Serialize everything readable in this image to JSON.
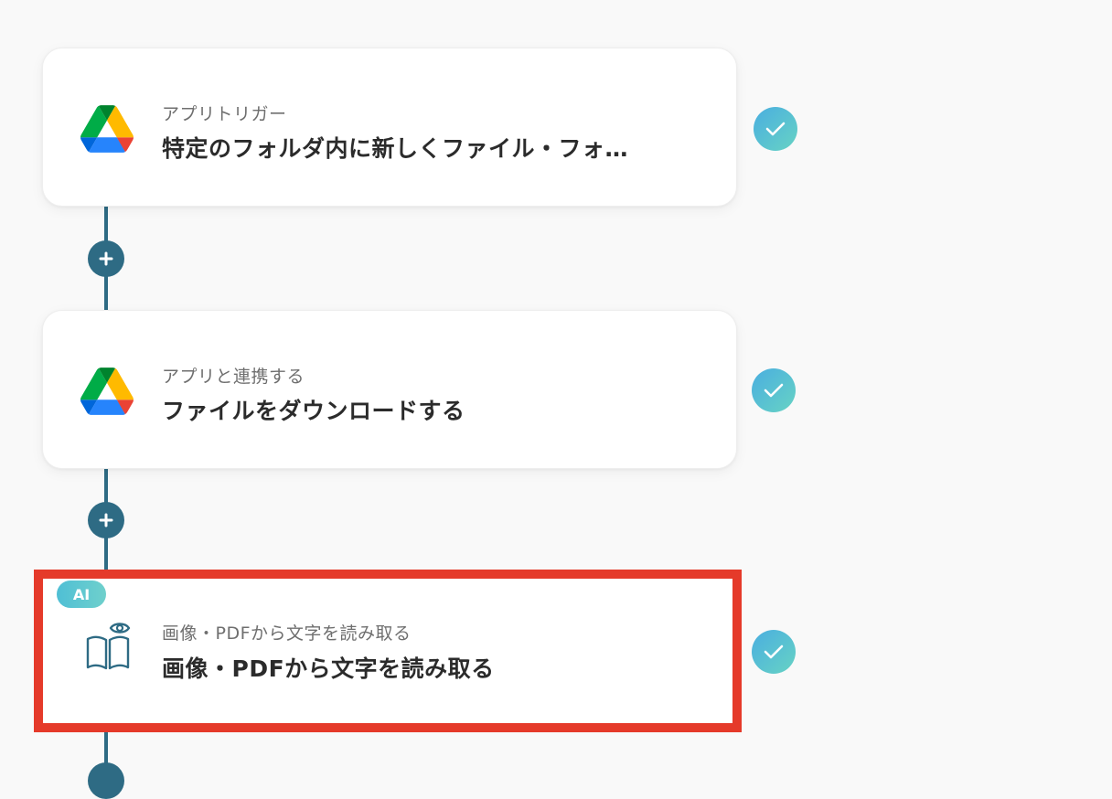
{
  "steps": [
    {
      "subtitle": "アプリトリガー",
      "title": "特定のフォルダ内に新しくファイル・フォ…",
      "icon": "google-drive-icon",
      "status": "completed"
    },
    {
      "subtitle": "アプリと連携する",
      "title": "ファイルをダウンロードする",
      "icon": "google-drive-icon",
      "status": "completed"
    },
    {
      "subtitle": "画像・PDFから文字を読み取る",
      "title": "画像・PDFから文字を読み取る",
      "icon": "book-eye-icon",
      "badge": "AI",
      "status": "completed",
      "selected": true
    }
  ],
  "colors": {
    "connector": "#2e6b84",
    "selection_border": "#e53a2a",
    "check_gradient_start": "#4aaee0",
    "check_gradient_end": "#67d3c4",
    "ai_badge": "#4fbfd5"
  }
}
